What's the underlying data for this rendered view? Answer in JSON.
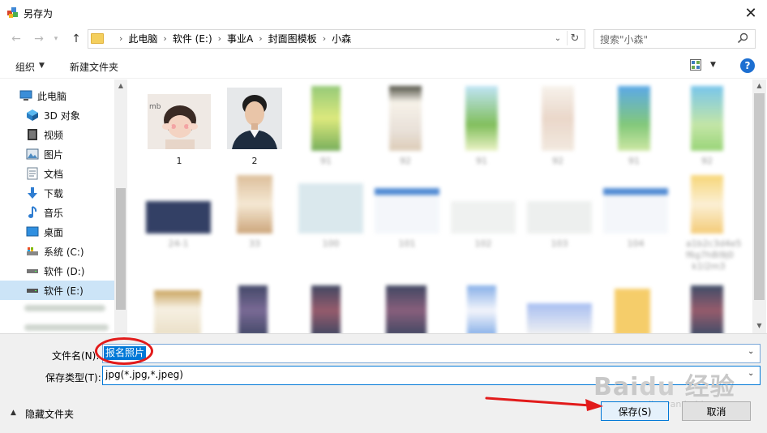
{
  "window": {
    "title": "另存为"
  },
  "address": {
    "crumbs": [
      "此电脑",
      "软件 (E:)",
      "事业A",
      "封面图模板",
      "小森"
    ]
  },
  "search": {
    "placeholder": "搜索\"小森\""
  },
  "toolbar": {
    "organize_label": "组织",
    "new_folder_label": "新建文件夹"
  },
  "nav": {
    "items": [
      {
        "label": "此电脑",
        "icon": "computer-icon"
      },
      {
        "label": "3D 对象",
        "icon": "cube-3d-icon"
      },
      {
        "label": "视频",
        "icon": "video-icon"
      },
      {
        "label": "图片",
        "icon": "picture-icon"
      },
      {
        "label": "文档",
        "icon": "document-icon"
      },
      {
        "label": "下载",
        "icon": "download-icon"
      },
      {
        "label": "音乐",
        "icon": "music-icon"
      },
      {
        "label": "桌面",
        "icon": "desktop-icon"
      },
      {
        "label": "系统 (C:)",
        "icon": "drive-c-icon"
      },
      {
        "label": "软件 (D:)",
        "icon": "drive-icon"
      },
      {
        "label": "软件 (E:)",
        "icon": "drive-icon"
      }
    ]
  },
  "files": [
    {
      "label": "1"
    },
    {
      "label": "2"
    }
  ],
  "form": {
    "filename_label": "文件名(N):",
    "filename_value": "报名照片",
    "filetype_label": "保存类型(T):",
    "filetype_value": "jpg(*.jpg,*.jpeg)"
  },
  "footer": {
    "hide_folders_label": "隐藏文件夹",
    "save_label": "保存(S)",
    "cancel_label": "取消"
  },
  "colors": {
    "accent": "#0078d7",
    "annotation_red": "#e21b1b"
  }
}
